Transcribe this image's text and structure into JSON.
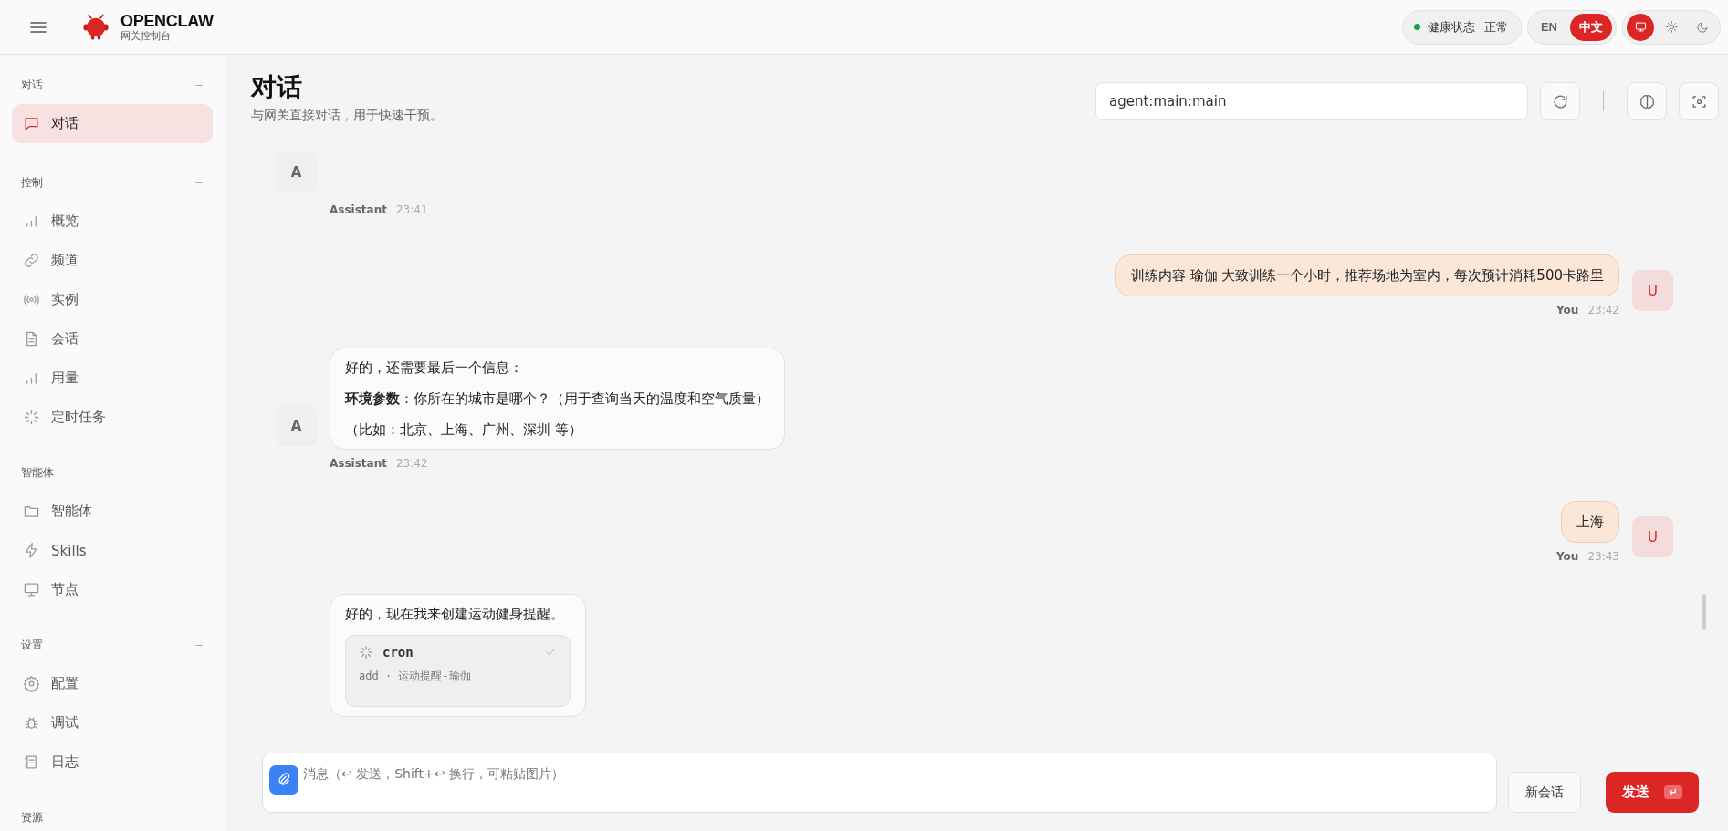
{
  "header": {
    "brand": {
      "title": "OPENCLAW",
      "subtitle": "网关控制台"
    },
    "health": {
      "label": "健康状态",
      "value": "正常",
      "ok": true
    },
    "languages": [
      {
        "label": "EN",
        "selected": false
      },
      {
        "label": "中文",
        "selected": true
      }
    ],
    "themes": [
      {
        "kind": "system",
        "selected": true
      },
      {
        "kind": "light",
        "selected": false
      },
      {
        "kind": "dark",
        "selected": false
      }
    ]
  },
  "sidebar": {
    "groups": [
      {
        "title": "对话",
        "toggle": "−",
        "items": [
          {
            "label": "对话",
            "selected": true
          }
        ]
      },
      {
        "title": "控制",
        "toggle": "−",
        "items": [
          {
            "label": "概览",
            "selected": false
          },
          {
            "label": "频道",
            "selected": false
          },
          {
            "label": "实例",
            "selected": false
          },
          {
            "label": "会话",
            "selected": false
          },
          {
            "label": "用量",
            "selected": false
          },
          {
            "label": "定时任务",
            "selected": false
          }
        ]
      },
      {
        "title": "智能体",
        "toggle": "−",
        "items": [
          {
            "label": "智能体",
            "selected": false
          },
          {
            "label": "Skills",
            "selected": false
          },
          {
            "label": "节点",
            "selected": false
          }
        ]
      },
      {
        "title": "设置",
        "toggle": "−",
        "items": [
          {
            "label": "配置",
            "selected": false
          },
          {
            "label": "调试",
            "selected": false
          },
          {
            "label": "日志",
            "selected": false
          }
        ]
      },
      {
        "title": "资源"
      }
    ]
  },
  "page": {
    "title": "对话",
    "subtitle": "与网关直接对话，用于快速干预。",
    "session": "agent:main:main"
  },
  "messages": [
    {
      "kind": "assistant",
      "avatar": "A",
      "author": "Assistant",
      "time": "23:41"
    },
    {
      "kind": "user",
      "avatar": "U",
      "author": "You",
      "time": "23:42",
      "paragraphs": [
        "训练内容 瑜伽 大致训练一个小时，推荐场地为室内，每次预计消耗500卡路里"
      ]
    },
    {
      "kind": "assistant",
      "avatar": "A",
      "author": "Assistant",
      "time": "23:42",
      "paragraphs": [
        "好的，还需要最后一个信息：",
        "**环境参数**：你所在的城市是哪个？（用于查询当天的温度和空气质量）",
        "（比如：北京、上海、广州、深圳 等）"
      ]
    },
    {
      "kind": "user",
      "avatar": "U",
      "author": "You",
      "time": "23:43",
      "paragraphs": [
        "上海"
      ]
    },
    {
      "kind": "assistant",
      "paragraphs": [
        "好的，现在我来创建运动健身提醒。"
      ],
      "tool": {
        "name": "cron",
        "detail": "add · 运动提醒-瑜伽",
        "done": true
      }
    }
  ],
  "composer": {
    "placeholder": "消息（↩ 发送，Shift+↩ 换行，可粘贴图片）",
    "new_button": "新会话",
    "send_button": "发送",
    "send_shortcut": "↵"
  }
}
